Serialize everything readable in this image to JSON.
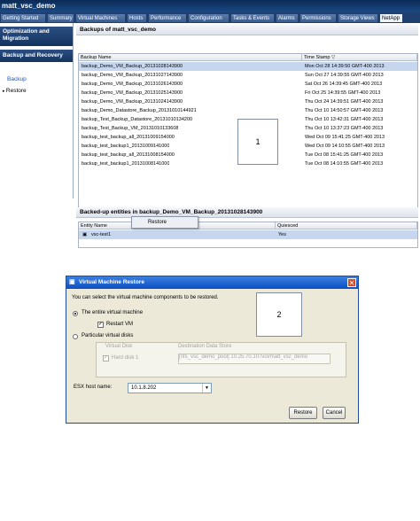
{
  "window": {
    "title": "matt_vsc_demo"
  },
  "tabs": [
    "Getting Started",
    "Summary",
    "Virtual Machines",
    "Hosts",
    "Performance",
    "Configuration",
    "Tasks & Events",
    "Alarms",
    "Permissions",
    "Storage Views",
    "NetApp"
  ],
  "sidebar": {
    "heading1": "Optimization and Migration",
    "heading2": "Backup and Recovery",
    "items": [
      "Backup",
      "Restore"
    ]
  },
  "backups": {
    "title": "Backups of matt_vsc_demo",
    "columns": [
      "Backup Name",
      "Time Stamp"
    ],
    "rows": [
      [
        "backup_Demo_VM_Backup_20131028143900",
        "Mon Oct 28 14:39:50 GMT-400 2013"
      ],
      [
        "backup_Demo_VM_Backup_20131027143900",
        "Sun Oct 27 14:39:55 GMT-400 2013"
      ],
      [
        "backup_Demo_VM_Backup_20131026143900",
        "Sat Oct 26 14:39:45 GMT-400 2013"
      ],
      [
        "backup_Demo_VM_Backup_20131025143900",
        "Fri Oct 25 14:39:55 GMT-400 2013"
      ],
      [
        "backup_Demo_VM_Backup_20131024143900",
        "Thu Oct 24 14:39:51 GMT-400 2013"
      ],
      [
        "backup_Demo_Datastore_Backup_20131010144921",
        "Thu Oct 10 14:50:57 GMT-400 2013"
      ],
      [
        "backup_Test_Backup_Datastore_20131010134200",
        "Thu Oct 10 13:42:31 GMT-400 2013"
      ],
      [
        "backup_Test_Backup_VM_20131010133608",
        "Thu Oct 10 13:37:23 GMT-400 2013"
      ],
      [
        "backup_test_backup_all_20131009154000",
        "Wed Oct 09 15:41:25 GMT-400 2013"
      ],
      [
        "backup_test_backup1_20131009141000",
        "Wed Oct 09 14:10:55 GMT-400 2013"
      ],
      [
        "backup_test_backup_all_20131008154000",
        "Tue Oct 08 15:41:25 GMT-400 2013"
      ],
      [
        "backup_test_backup1_20131008141000",
        "Tue Oct 08 14:10:55 GMT-400 2013"
      ]
    ]
  },
  "entities": {
    "title": "Backed-up entities in backup_Demo_VM_Backup_20131028143900",
    "columns": [
      "Entity Name",
      "Quiesced"
    ],
    "rows": [
      [
        "vsc-test1",
        "Yes"
      ]
    ]
  },
  "context_menu": {
    "item": "Restore"
  },
  "callout1": "1",
  "callout2": "2",
  "dialog": {
    "title": "Virtual Machine Restore",
    "instruction": "You can select the virtual machine components to be restored.",
    "option_entire": "The entire virtual machine",
    "restart_vm": "Restart VM",
    "option_disks": "Particular virtual disks",
    "disk_columns": [
      "Virtual Disk",
      "Destination Data Store"
    ],
    "disk_row": [
      "Hard disk 1",
      "[nfs_vsc_demo_pool] 10.25.70.10:/vol/matt_vsc_demo"
    ],
    "esx_label": "ESX host name:",
    "esx_value": "10.1.8.202",
    "restore_button": "Restore",
    "cancel_button": "Cancel"
  }
}
